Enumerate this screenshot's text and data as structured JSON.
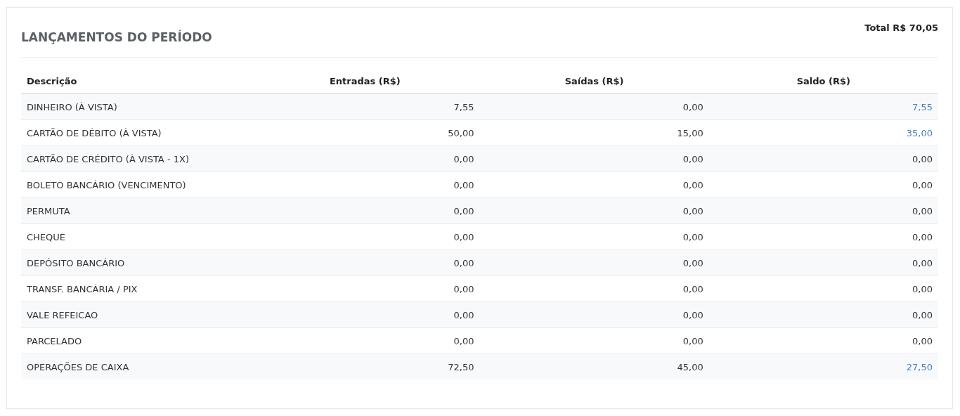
{
  "panel": {
    "title": "LANÇAMENTOS DO PERÍODO",
    "total": "Total R$ 70,05"
  },
  "table": {
    "columns": [
      "Descrição",
      "Entradas (R$)",
      "Saídas (R$)",
      "Saldo (R$)"
    ],
    "rows": [
      {
        "descricao": "DINHEIRO (À VISTA)",
        "entradas": "7,55",
        "saidas": "0,00",
        "saldo": "7,55",
        "saldo_highlighted": true
      },
      {
        "descricao": "CARTÃO DE DÉBITO (À VISTA)",
        "entradas": "50,00",
        "saidas": "15,00",
        "saldo": "35,00",
        "saldo_highlighted": true
      },
      {
        "descricao": "CARTÃO DE CRÉDITO (À VISTA - 1X)",
        "entradas": "0,00",
        "saidas": "0,00",
        "saldo": "0,00",
        "saldo_highlighted": false
      },
      {
        "descricao": "BOLETO BANCÁRIO (VENCIMENTO)",
        "entradas": "0,00",
        "saidas": "0,00",
        "saldo": "0,00",
        "saldo_highlighted": false
      },
      {
        "descricao": "PERMUTA",
        "entradas": "0,00",
        "saidas": "0,00",
        "saldo": "0,00",
        "saldo_highlighted": false
      },
      {
        "descricao": "CHEQUE",
        "entradas": "0,00",
        "saidas": "0,00",
        "saldo": "0,00",
        "saldo_highlighted": false
      },
      {
        "descricao": "DEPÓSITO BANCÁRIO",
        "entradas": "0,00",
        "saidas": "0,00",
        "saldo": "0,00",
        "saldo_highlighted": false
      },
      {
        "descricao": "TRANSF. BANCÁRIA / PIX",
        "entradas": "0,00",
        "saidas": "0,00",
        "saldo": "0,00",
        "saldo_highlighted": false
      },
      {
        "descricao": "VALE REFEICAO",
        "entradas": "0,00",
        "saidas": "0,00",
        "saldo": "0,00",
        "saldo_highlighted": false
      },
      {
        "descricao": "PARCELADO",
        "entradas": "0,00",
        "saidas": "0,00",
        "saldo": "0,00",
        "saldo_highlighted": false
      },
      {
        "descricao": "OPERAÇÕES DE CAIXA",
        "entradas": "72,50",
        "saidas": "45,00",
        "saldo": "27,50",
        "saldo_highlighted": true
      }
    ]
  }
}
